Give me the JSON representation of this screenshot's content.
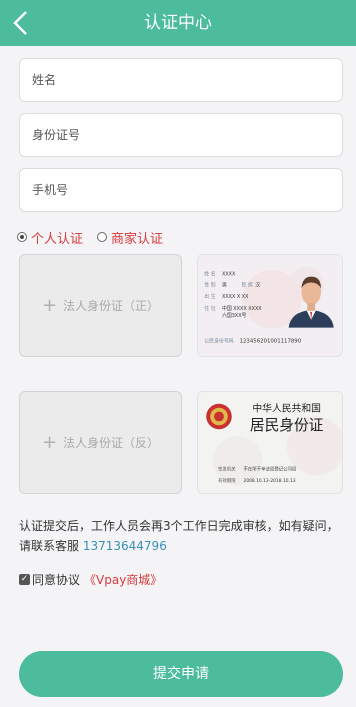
{
  "header": {
    "title": "认证中心"
  },
  "form": {
    "name_placeholder": "姓名",
    "id_placeholder": "身份证号",
    "phone_placeholder": "手机号"
  },
  "type_options": [
    {
      "label": "个人认证",
      "selected": true
    },
    {
      "label": "商家认证",
      "selected": false
    }
  ],
  "uploads": {
    "front_label": "法人身份证（正）",
    "back_label": "法人身份证（反）"
  },
  "samples": {
    "front": {
      "name_key": "姓 名",
      "name_value": "XXXX",
      "sex_key": "性 别",
      "sex_value": "男",
      "ethnic_key": "民 族",
      "ethnic_value": "汉",
      "birth_key": "出 生",
      "birth_value": "XXXX X XX",
      "address_key": "住 址",
      "address_value": "中国 XXXX XXXX",
      "address_value2": "六国3XX号",
      "id_key": "公民身份号码",
      "id_value": "123456201001117890"
    },
    "back": {
      "country": "中华人民共和国",
      "title": "居民身份证",
      "authority_key": "签发机关",
      "authority_value": "不在所干辛法局登记公司局",
      "validity_key": "有效期限",
      "validity_value": "2008.10.13-2018.10.13"
    }
  },
  "notice": {
    "text": "认证提交后，工作人员会再3个工作日完成审核，如有疑问，请联系客服",
    "phone": "13713644796"
  },
  "agreement": {
    "check": "✓",
    "label": "同意协议",
    "link": "《Vpay商城》"
  },
  "submit_label": "提交申请",
  "colors": {
    "primary": "#4dbc9c",
    "accent_red": "#d9393a",
    "link_blue": "#3a8fb7"
  }
}
